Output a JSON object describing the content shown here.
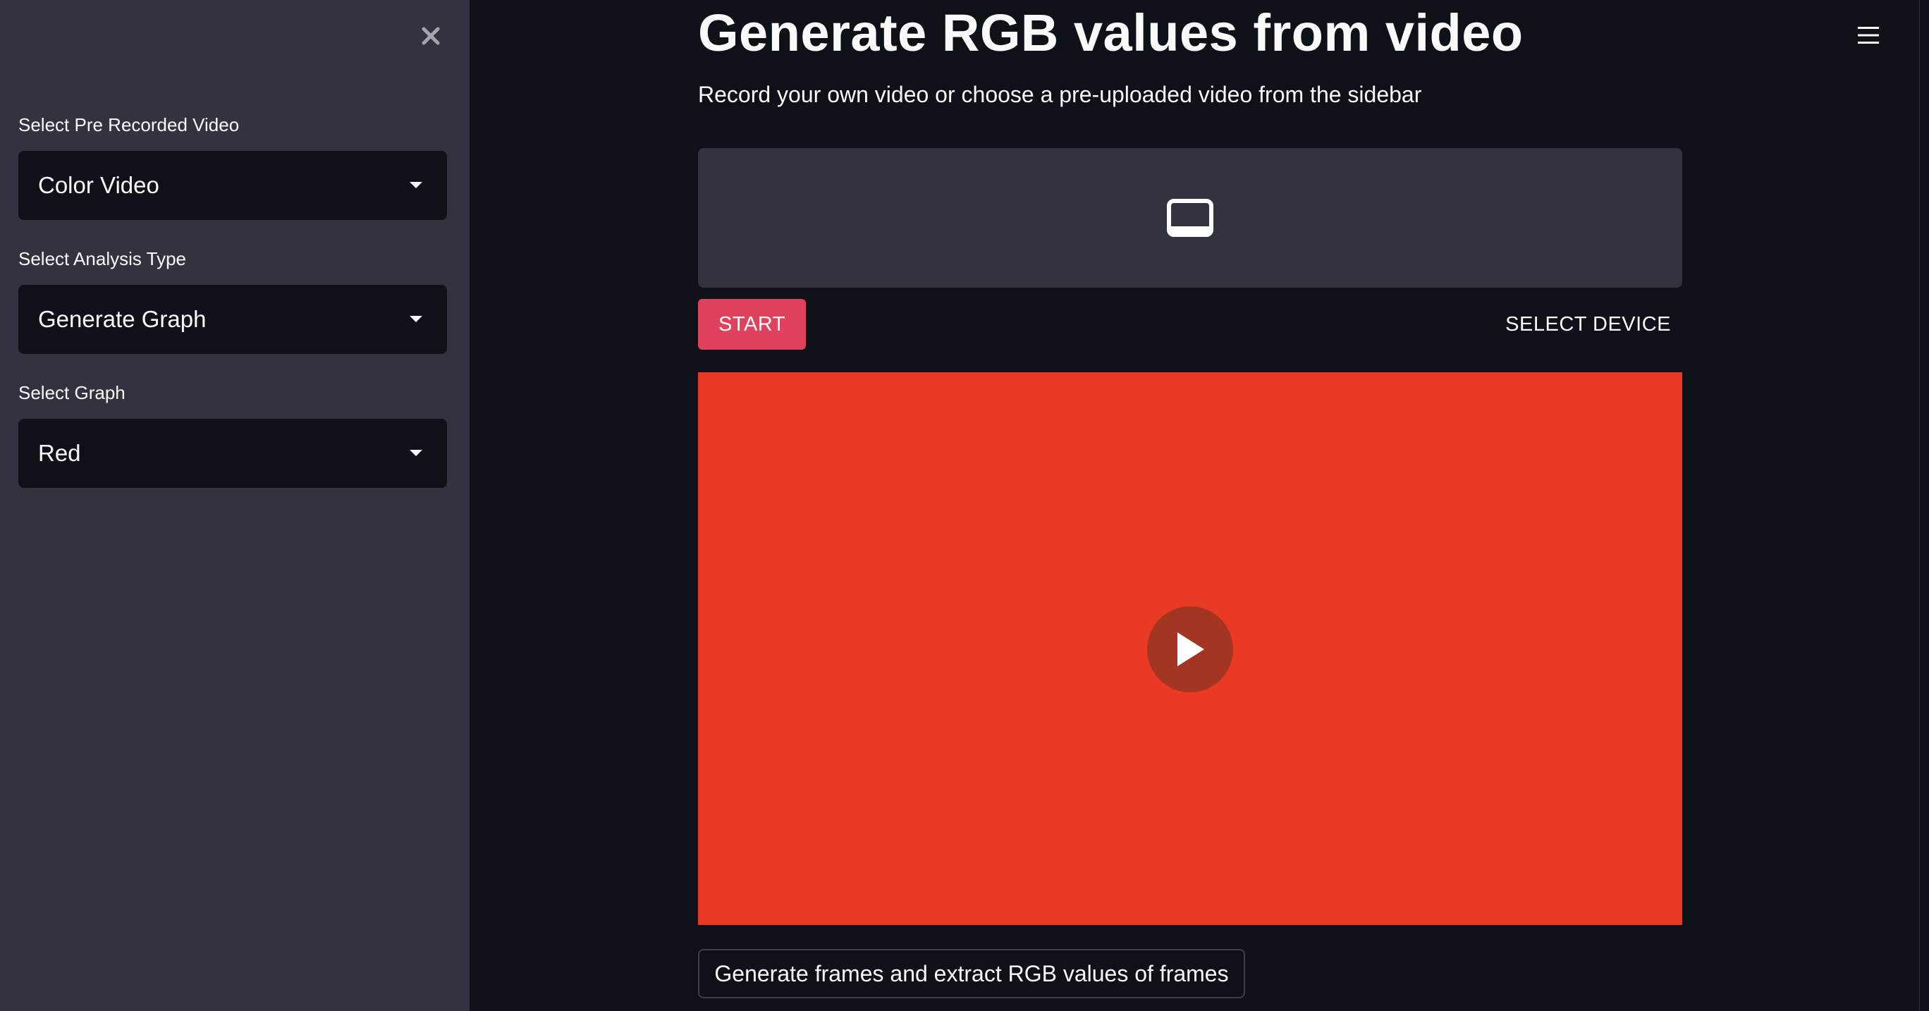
{
  "sidebar": {
    "close_icon": "close-icon",
    "fields": [
      {
        "label": "Select Pre Recorded Video",
        "value": "Color Video"
      },
      {
        "label": "Select Analysis Type",
        "value": "Generate Graph"
      },
      {
        "label": "Select Graph",
        "value": "Red"
      }
    ]
  },
  "main": {
    "title": "Generate RGB values from video",
    "subtitle": "Record your own video or choose a pre-uploaded video from the sidebar",
    "menu_icon": "hamburger-menu-icon",
    "device_panel_icon": "monitor-icon",
    "start_label": "START",
    "select_device_label": "SELECT DEVICE",
    "video": {
      "background_color": "#ea3a26",
      "play_icon": "play-icon"
    },
    "action_button_label": "Generate frames and extract RGB values of frames"
  },
  "colors": {
    "background": "#0e1117",
    "sidebar": "#31333f",
    "accent": "#e0415c",
    "video": "#ea3a26"
  }
}
